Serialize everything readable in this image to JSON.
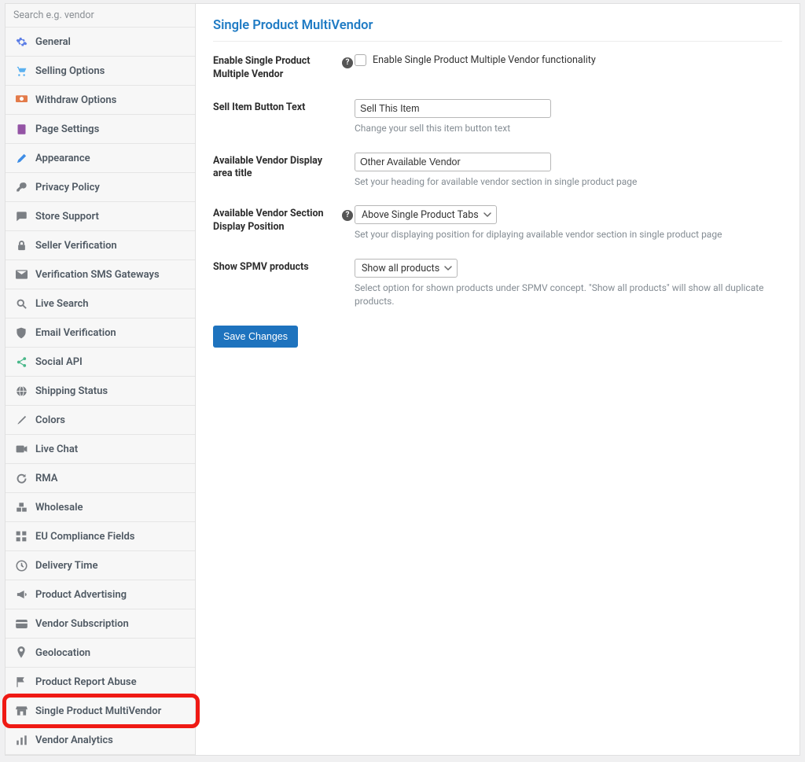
{
  "sidebar": {
    "search_placeholder": "Search e.g. vendor",
    "items": [
      {
        "label": "General",
        "icon": "gear",
        "color": "#5c7ee6"
      },
      {
        "label": "Selling Options",
        "icon": "cart",
        "color": "#5bb1f0"
      },
      {
        "label": "Withdraw Options",
        "icon": "withdraw",
        "color": "#e37b4a"
      },
      {
        "label": "Page Settings",
        "icon": "page",
        "color": "#9454a5"
      },
      {
        "label": "Appearance",
        "icon": "brush",
        "color": "#3e8de6"
      },
      {
        "label": "Privacy Policy",
        "icon": "key",
        "color": "#7b7f84"
      },
      {
        "label": "Store Support",
        "icon": "chat",
        "color": "#7b7f84"
      },
      {
        "label": "Seller Verification",
        "icon": "lock",
        "color": "#7b7f84"
      },
      {
        "label": "Verification SMS Gateways",
        "icon": "mail",
        "color": "#7b7f84"
      },
      {
        "label": "Live Search",
        "icon": "search",
        "color": "#7b7f84"
      },
      {
        "label": "Email Verification",
        "icon": "shield",
        "color": "#7b7f84"
      },
      {
        "label": "Social API",
        "icon": "share",
        "color": "#4ab88a"
      },
      {
        "label": "Shipping Status",
        "icon": "globe",
        "color": "#7b7f84"
      },
      {
        "label": "Colors",
        "icon": "paint",
        "color": "#7b7f84"
      },
      {
        "label": "Live Chat",
        "icon": "video",
        "color": "#7b7f84"
      },
      {
        "label": "RMA",
        "icon": "refresh",
        "color": "#7b7f84"
      },
      {
        "label": "Wholesale",
        "icon": "boxes",
        "color": "#7b7f84"
      },
      {
        "label": "EU Compliance Fields",
        "icon": "grid",
        "color": "#7b7f84"
      },
      {
        "label": "Delivery Time",
        "icon": "clock",
        "color": "#7b7f84"
      },
      {
        "label": "Product Advertising",
        "icon": "megaphone",
        "color": "#7b7f84"
      },
      {
        "label": "Vendor Subscription",
        "icon": "card",
        "color": "#7b7f84"
      },
      {
        "label": "Geolocation",
        "icon": "pin",
        "color": "#7b7f84"
      },
      {
        "label": "Product Report Abuse",
        "icon": "flag",
        "color": "#7b7f84"
      },
      {
        "label": "Single Product MultiVendor",
        "icon": "store",
        "color": "#7b7f84",
        "highlight": true
      },
      {
        "label": "Vendor Analytics",
        "icon": "analytics",
        "color": "#7b7f84"
      }
    ]
  },
  "page": {
    "title": "Single Product MultiVendor",
    "enable": {
      "label": "Enable Single Product Multiple Vendor",
      "checkbox_label": "Enable Single Product Multiple Vendor functionality"
    },
    "sell_button": {
      "label": "Sell Item Button Text",
      "value": "Sell This Item",
      "hint": "Change your sell this item button text"
    },
    "area_title": {
      "label": "Available Vendor Display area title",
      "value": "Other Available Vendor",
      "hint": "Set your heading for available vendor section in single product page"
    },
    "display_position": {
      "label": "Available Vendor Section Display Position",
      "value": "Above Single Product Tabs",
      "hint": "Set your displaying position for diplaying available vendor section in single product page"
    },
    "spmv": {
      "label": "Show SPMV products",
      "value": "Show all products",
      "hint": "Select option for shown products under SPMV concept. \"Show all products\" will show all duplicate products."
    },
    "save_label": "Save Changes"
  }
}
